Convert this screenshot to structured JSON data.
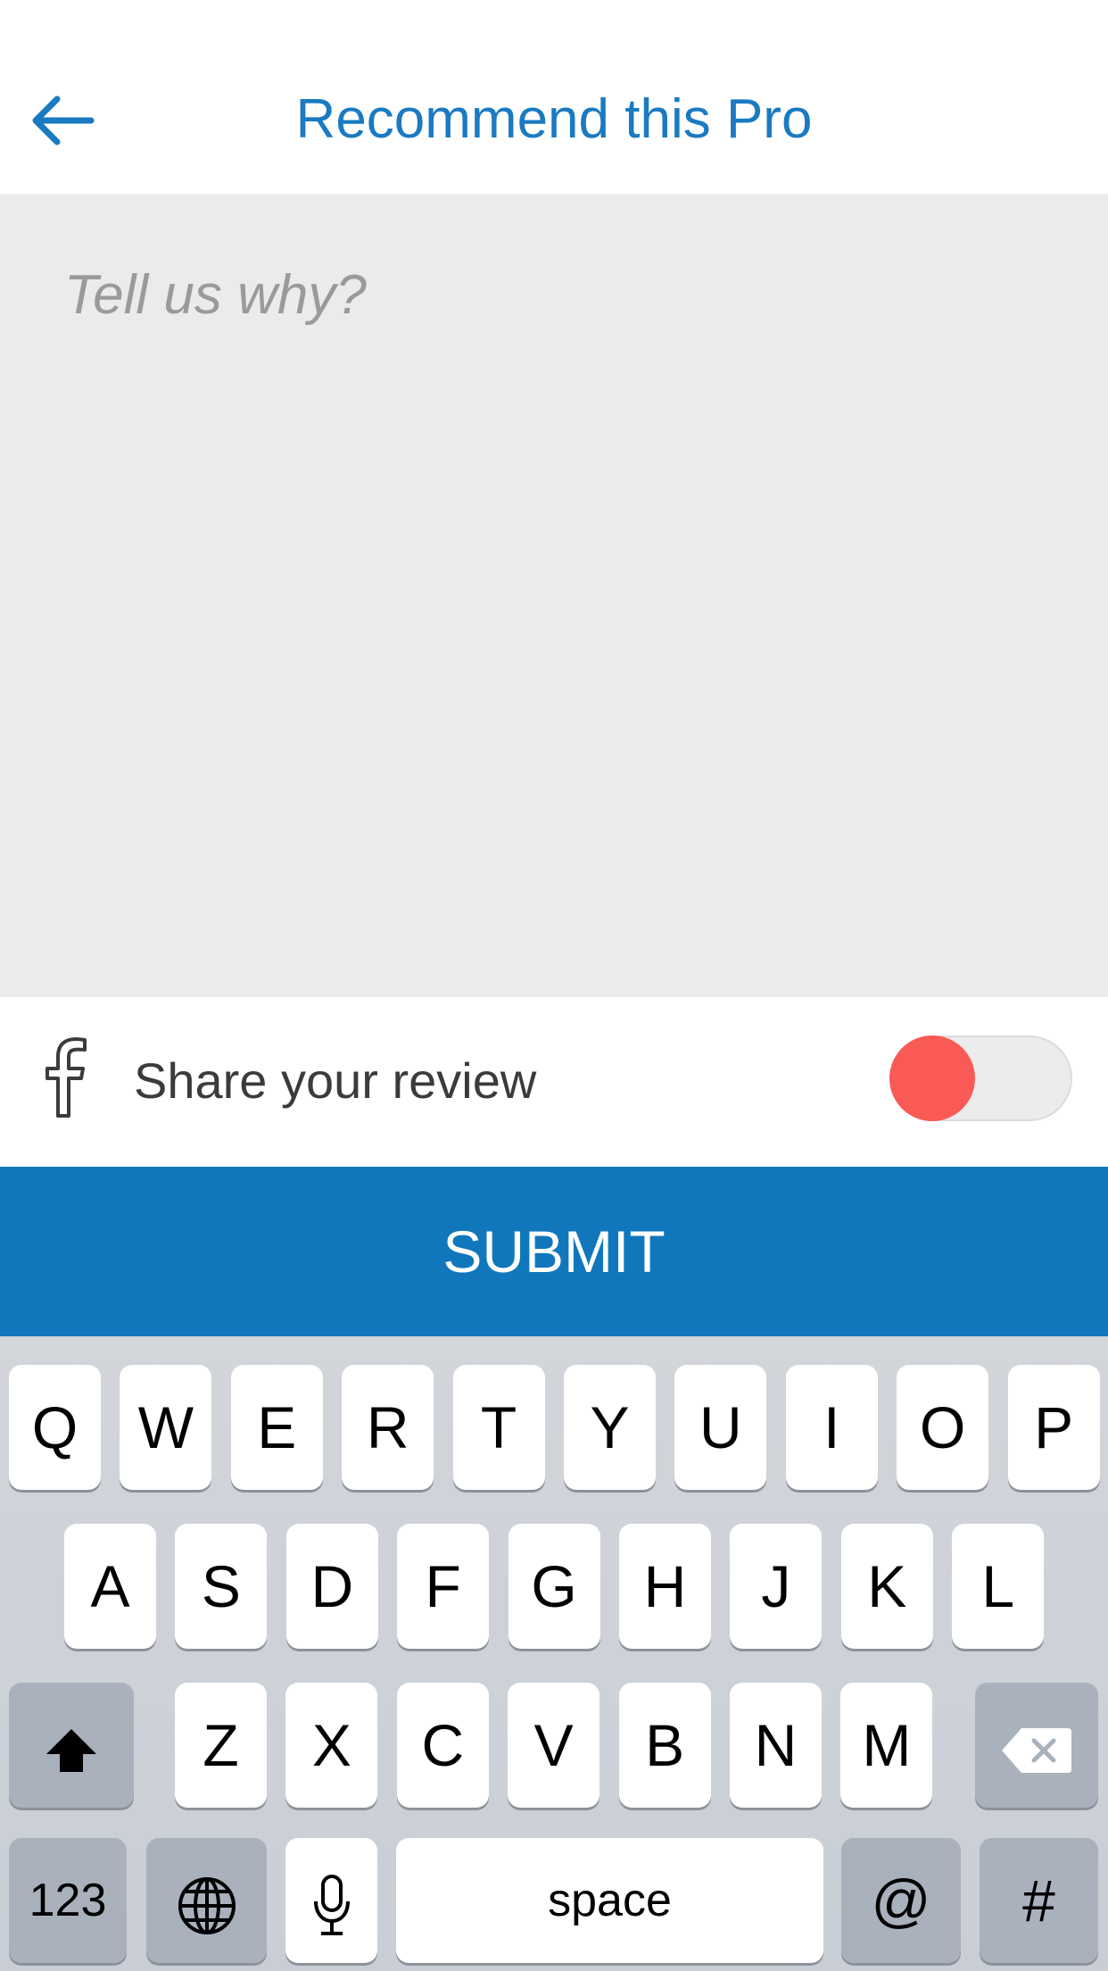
{
  "header": {
    "title": "Recommend this Pro"
  },
  "review": {
    "placeholder": "Tell us why?"
  },
  "share": {
    "label": "Share your review",
    "toggle_on": false
  },
  "submit": {
    "label": "SUBMIT"
  },
  "colors": {
    "accent": "#1a7ac2",
    "submit_bg": "#1077bd",
    "toggle_knob": "#fa5a55"
  },
  "icons": [
    "back-arrow-icon",
    "facebook-icon",
    "shift-icon",
    "delete-icon",
    "globe-icon",
    "microphone-icon"
  ],
  "keyboard": {
    "row1": [
      "Q",
      "W",
      "E",
      "R",
      "T",
      "Y",
      "U",
      "I",
      "O",
      "P"
    ],
    "row2": [
      "A",
      "S",
      "D",
      "F",
      "G",
      "H",
      "J",
      "K",
      "L"
    ],
    "row3": [
      "Z",
      "X",
      "C",
      "V",
      "B",
      "N",
      "M"
    ],
    "numbers_label": "123",
    "space_label": "space",
    "at_label": "@",
    "hash_label": "#"
  }
}
